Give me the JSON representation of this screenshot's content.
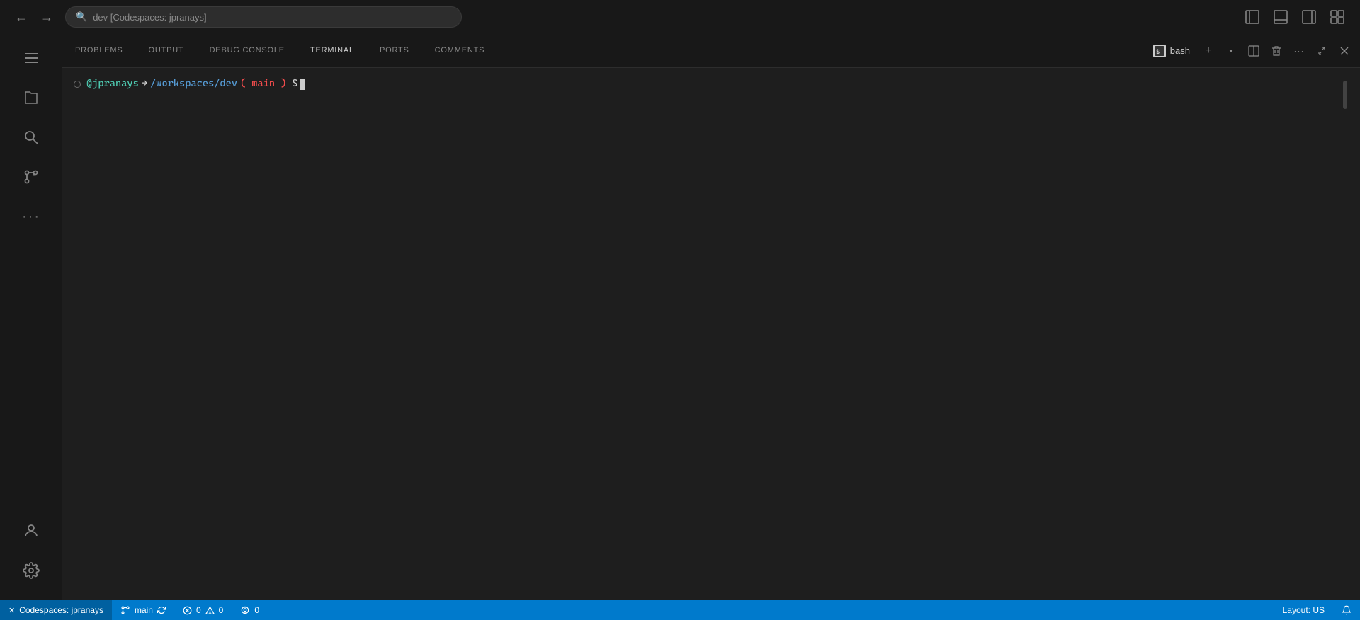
{
  "titlebar": {
    "nav": {
      "back_label": "←",
      "forward_label": "→"
    },
    "search": {
      "placeholder": "dev [Codespaces: jpranays]"
    },
    "right_icons": [
      {
        "name": "toggle-primary-sidebar",
        "symbol": "⬜"
      },
      {
        "name": "toggle-panel",
        "symbol": "⬛"
      },
      {
        "name": "toggle-secondary-sidebar",
        "symbol": "⬜"
      },
      {
        "name": "customize-layout",
        "symbol": "⊡"
      }
    ]
  },
  "activity_bar": {
    "top_items": [
      {
        "name": "menu",
        "symbol": "≡"
      },
      {
        "name": "explorer",
        "symbol": "📄"
      },
      {
        "name": "search",
        "symbol": "🔍"
      },
      {
        "name": "source-control",
        "symbol": "⑂"
      },
      {
        "name": "extensions",
        "symbol": "⋯"
      }
    ],
    "bottom_items": [
      {
        "name": "account",
        "symbol": "👤"
      },
      {
        "name": "settings",
        "symbol": "⚙"
      }
    ]
  },
  "panel": {
    "tabs": [
      {
        "id": "problems",
        "label": "PROBLEMS"
      },
      {
        "id": "output",
        "label": "OUTPUT"
      },
      {
        "id": "debug-console",
        "label": "DEBUG CONSOLE"
      },
      {
        "id": "terminal",
        "label": "TERMINAL",
        "active": true
      },
      {
        "id": "ports",
        "label": "PORTS"
      },
      {
        "id": "comments",
        "label": "COMMENTS"
      }
    ],
    "terminal": {
      "shell_name": "bash",
      "prompt": {
        "user": "@jpranays",
        "arrow": "→",
        "path": "/workspaces/dev",
        "branch_open": "(",
        "branch": "main",
        "branch_close": ")",
        "dollar": "$"
      }
    },
    "actions": {
      "new_terminal": "+",
      "split": "⬜",
      "delete": "🗑",
      "more": "···",
      "chevron_down": "∨",
      "close": "✕"
    }
  },
  "status_bar": {
    "left": [
      {
        "name": "codespace",
        "icon": "✕",
        "label": "Codespaces: jpranays"
      },
      {
        "name": "branch",
        "icon": "⑂",
        "label": "main"
      },
      {
        "name": "sync",
        "icon": "↻",
        "label": ""
      },
      {
        "name": "errors",
        "icon": "⊗",
        "value": "0"
      },
      {
        "name": "warnings",
        "icon": "⚠",
        "value": "0"
      },
      {
        "name": "ports",
        "icon": "((●))",
        "value": "0"
      }
    ],
    "right": [
      {
        "name": "layout",
        "label": "Layout: US"
      },
      {
        "name": "notifications",
        "icon": "🔔",
        "label": ""
      }
    ]
  }
}
